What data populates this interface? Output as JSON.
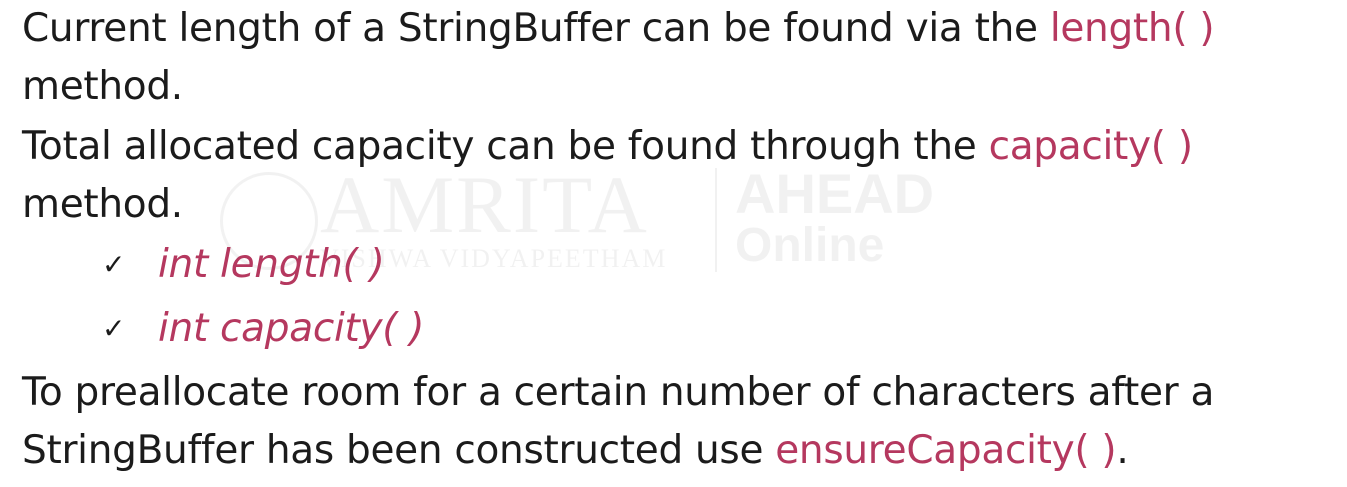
{
  "watermark": {
    "name": "AMRITA",
    "sub": "VISHWA VIDYAPEETHAM",
    "ahead": "AHEAD",
    "online": "Online"
  },
  "content": {
    "p1": {
      "text_a": "Current length of a StringBuffer can be found via the ",
      "method": "length( )",
      "text_b": "method."
    },
    "p2": {
      "text_a": "Total allocated capacity can be found through the ",
      "method": "capacity( )",
      "text_b": "method."
    },
    "bullets": [
      {
        "check": "✓",
        "code": "int length( )"
      },
      {
        "check": "✓",
        "code": "int capacity( )"
      }
    ],
    "p3": {
      "text_a": "To preallocate room for a certain number of characters after a",
      "text_b": "StringBuffer has been constructed use ",
      "method": "ensureCapacity( )",
      "text_c": "."
    }
  },
  "colors": {
    "text": "#1b1b1b",
    "highlight": "#b5385f",
    "background": "#ffffff"
  }
}
